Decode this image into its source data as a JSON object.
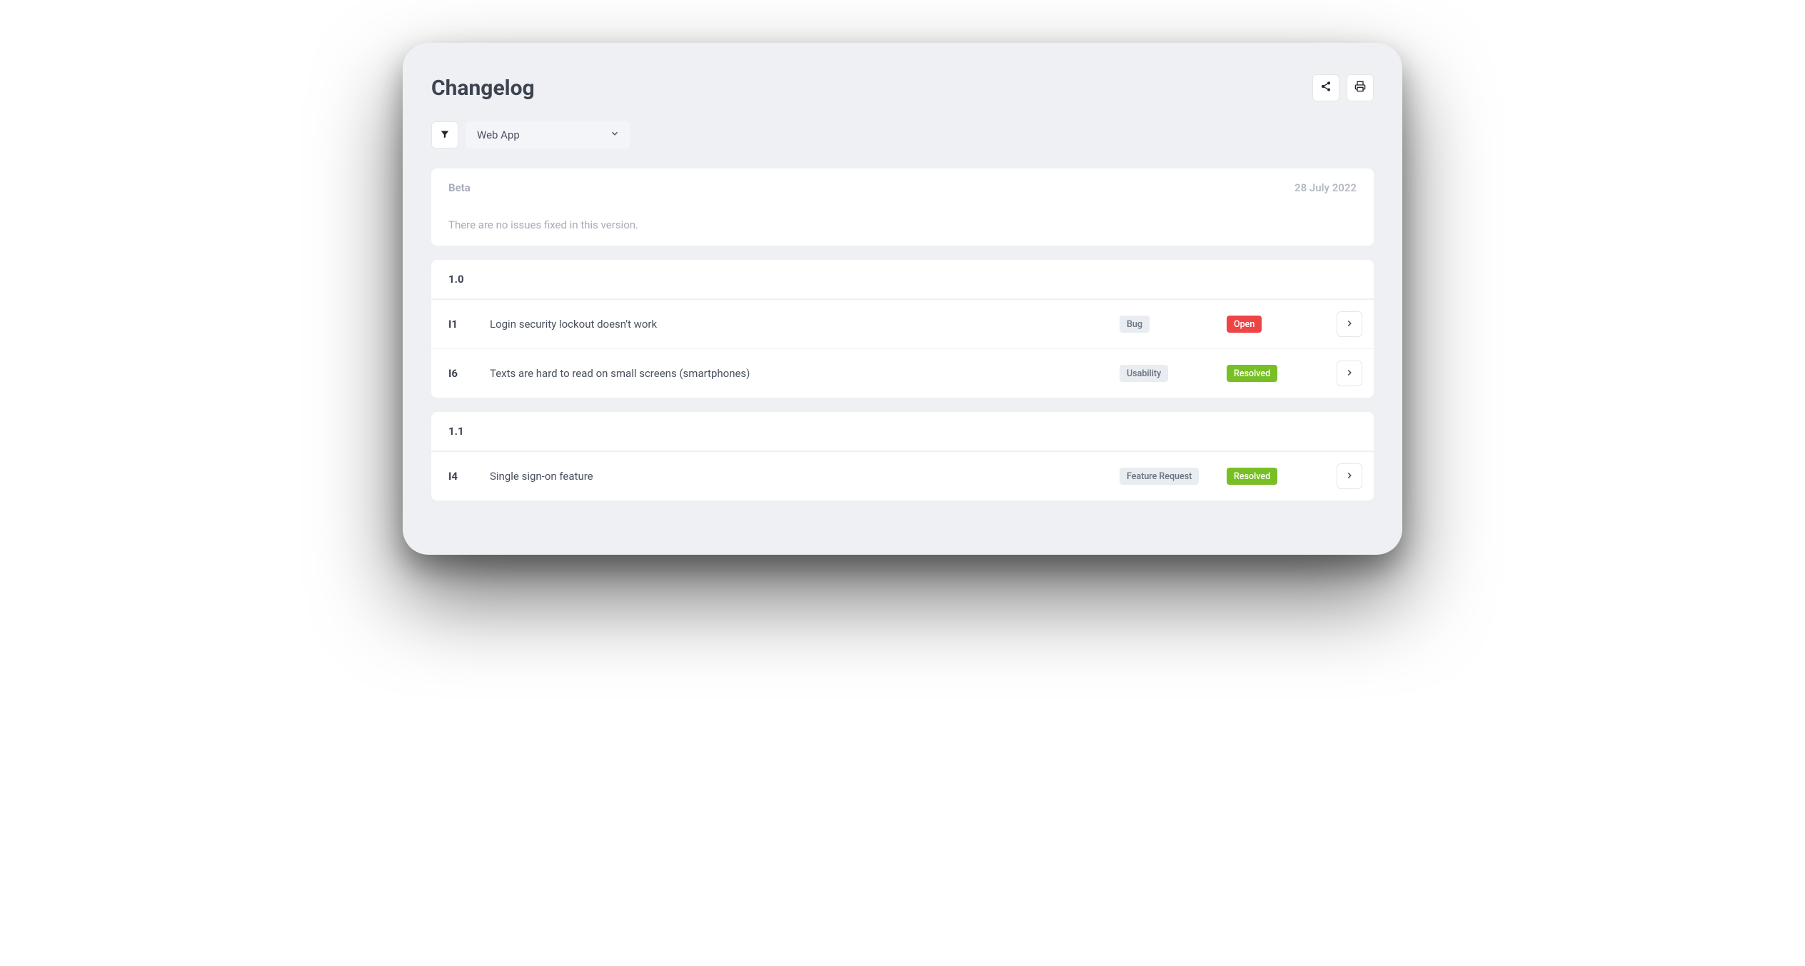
{
  "header": {
    "title": "Changelog"
  },
  "filters": {
    "selected": "Web App"
  },
  "sections": [
    {
      "version": "Beta",
      "muted": true,
      "date": "28 July 2022",
      "empty_message": "There are no issues fixed in this version.",
      "issues": []
    },
    {
      "version": "1.0",
      "muted": false,
      "date": "",
      "empty_message": "",
      "issues": [
        {
          "id": "I1",
          "title": "Login security lockout doesn't work",
          "type": "Bug",
          "status": "Open",
          "status_color": "red"
        },
        {
          "id": "I6",
          "title": "Texts are hard to read on small screens (smartphones)",
          "type": "Usability",
          "status": "Resolved",
          "status_color": "green"
        }
      ]
    },
    {
      "version": "1.1",
      "muted": false,
      "date": "",
      "empty_message": "",
      "issues": [
        {
          "id": "I4",
          "title": "Single sign-on feature",
          "type": "Feature Request",
          "status": "Resolved",
          "status_color": "green"
        }
      ]
    }
  ]
}
